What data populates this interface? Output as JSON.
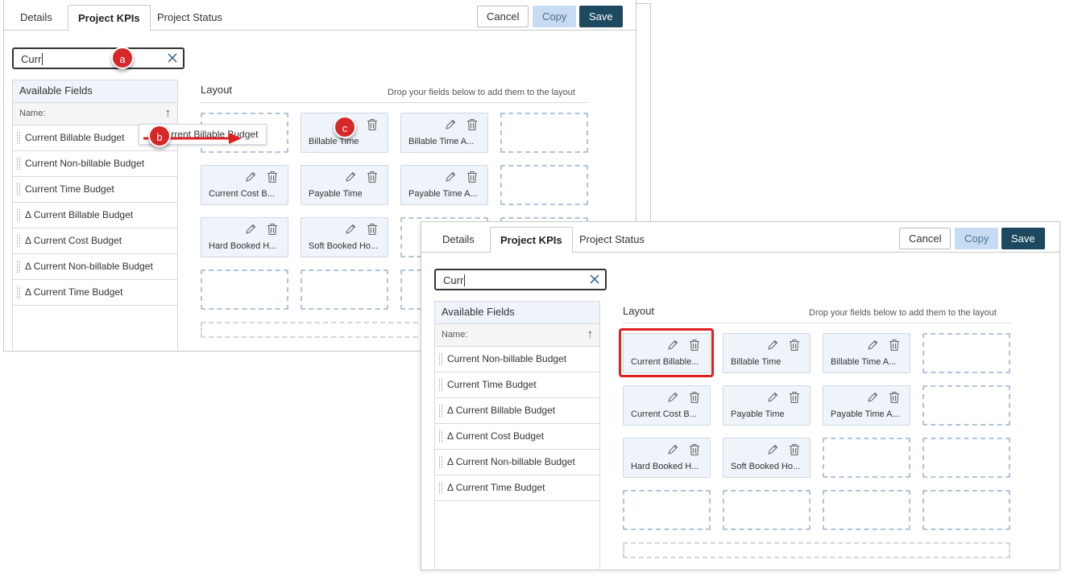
{
  "tabs": [
    "Details",
    "Project KPIs",
    "Project Status"
  ],
  "buttons": {
    "cancel": "Cancel",
    "copy": "Copy",
    "save": "Save"
  },
  "search": {
    "value": "Curr"
  },
  "fields": {
    "header": "Available Fields",
    "sort_label": "Name:",
    "sort_icon": "↑"
  },
  "before": {
    "items": [
      "Current Billable Budget",
      "Current Non-billable Budget",
      "Current Time Budget",
      "Δ Current Billable Budget",
      "Δ Current Cost Budget",
      "Δ Current Non-billable Budget",
      "Δ Current Time Budget"
    ],
    "drag_label": "Current Billable Budget"
  },
  "after": {
    "items": [
      "Current Non-billable Budget",
      "Current Time Budget",
      "Δ Current Billable Budget",
      "Δ Current Cost Budget",
      "Δ Current Non-billable Budget",
      "Δ Current Time Budget"
    ]
  },
  "layout": {
    "title": "Layout",
    "hint": "Drop your fields below to add them to the layout",
    "before_cells": [
      "",
      "Billable Time",
      "Billable Time A...",
      "",
      "Current Cost B...",
      "Payable Time",
      "Payable Time A...",
      "",
      "Hard Booked H...",
      "Soft Booked Ho...",
      "",
      "",
      "",
      "",
      "",
      ""
    ],
    "after_cells": [
      "Current Billable...",
      "Billable Time",
      "Billable Time A...",
      "",
      "Current Cost B...",
      "Payable Time",
      "Payable Time A...",
      "",
      "Hard Booked H...",
      "Soft Booked Ho...",
      "",
      "",
      "",
      "",
      "",
      ""
    ]
  },
  "markers": {
    "a": "a",
    "b": "b",
    "c": "c"
  },
  "colors": {
    "accent": "#1d4960",
    "copy": "#c7dcf2",
    "marker": "#d62828",
    "highlight": "#e02020"
  },
  "icons": {
    "edit": "pencil-icon",
    "delete": "trash-icon",
    "clear": "close-icon",
    "sort": "sort-arrow-icon"
  }
}
